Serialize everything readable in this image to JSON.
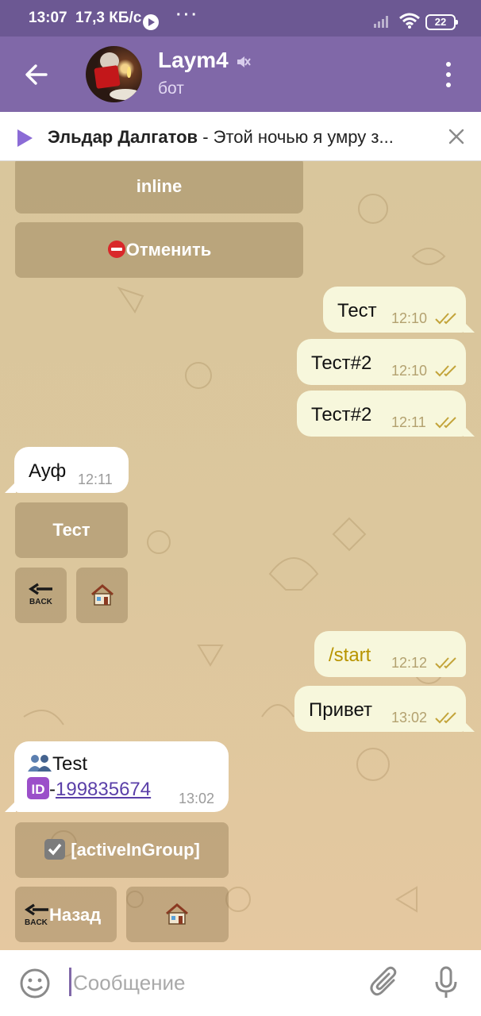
{
  "statusbar": {
    "time": "13:07",
    "speed": "17,3 КБ/с",
    "dots": "···",
    "battery": "22"
  },
  "header": {
    "title": "Laym4",
    "subtitle": "бот",
    "avatar_icon": "avatar-photo",
    "mute_icon": "muted-speaker-icon"
  },
  "pinned": {
    "author": "Эльдар Далгатов",
    "separator": " - ",
    "text": "Этой ночью я умру з..."
  },
  "keyboard_top": {
    "inline_label": "inline",
    "cancel_label": "Отменить",
    "cancel_icon": "no-entry-icon"
  },
  "messages": {
    "m1": {
      "text": "Тест",
      "time": "12:10"
    },
    "m2": {
      "text": "Тест#2",
      "time": "12:10"
    },
    "m3": {
      "text": "Тест#2",
      "time": "12:11"
    },
    "m4": {
      "text": "Ауф",
      "time": "12:11"
    },
    "m5": {
      "text": "/start",
      "time": "12:12"
    },
    "m6": {
      "text": "Привет",
      "time": "13:02"
    },
    "m7": {
      "line1": "Test",
      "id_prefix": "-",
      "id_link": "199835674",
      "time": "13:02"
    }
  },
  "keyboard_mid": {
    "test_label": "Тест",
    "back_icon_text": "BACK",
    "home_icon": "house-icon"
  },
  "keyboard_bottom": {
    "group_label": "[activeInGroup]",
    "back_label": "Назад",
    "back_icon_text": "BACK",
    "home_icon": "house-icon"
  },
  "input": {
    "placeholder": "Сообщение"
  },
  "colors": {
    "header": "#8068a8",
    "statusbar": "#6c5893",
    "outgoing_bubble": "#f7f7dc",
    "incoming_bubble": "#ffffff",
    "accent": "#8b6bd6"
  }
}
